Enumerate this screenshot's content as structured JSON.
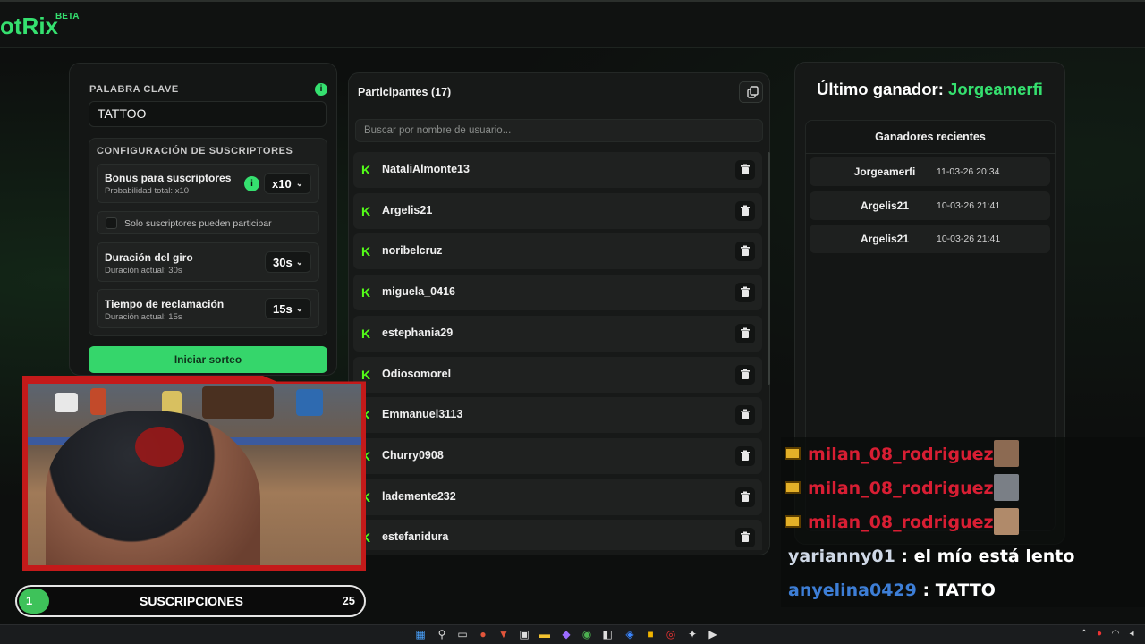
{
  "app": {
    "logo": "otRix",
    "beta": "BETA"
  },
  "settings": {
    "keyword_label": "PALABRA CLAVE",
    "keyword_value": "TATTOO",
    "subs_config_label": "CONFIGURACIÓN DE SUSCRIPTORES",
    "bonus_title": "Bonus para suscriptores",
    "bonus_sub": "Probabilidad total: x10",
    "bonus_value": "x10",
    "subs_only_label": "Solo suscriptores pueden participar",
    "spin_title": "Duración del giro",
    "spin_sub": "Duración actual: 30s",
    "spin_value": "30s",
    "claim_title": "Tiempo de reclamación",
    "claim_sub": "Duración actual: 15s",
    "claim_value": "15s",
    "start_label": "Iniciar sorteo",
    "info_glyph": "i"
  },
  "participants": {
    "title": "Participantes (17)",
    "search_placeholder": "Buscar por nombre de usuario...",
    "items": [
      "NataliAlmonte13",
      "Argelis21",
      "noribelcruz",
      "miguela_0416",
      "estephania29",
      "Odiosomorel",
      "Emmanuel3113",
      "Churry0908",
      "lademente232",
      "estefanidura"
    ]
  },
  "winner": {
    "label": "Último ganador:",
    "name": "Jorgeamerfi",
    "recent_title": "Ganadores recientes",
    "recent": [
      {
        "name": "Jorgeamerfi",
        "date": "11-03-26 20:34"
      },
      {
        "name": "Argelis21",
        "date": "10-03-26 21:41"
      },
      {
        "name": "Argelis21",
        "date": "10-03-26 21:41"
      }
    ]
  },
  "subs_goal": {
    "current": "1",
    "label": "SUSCRIPCIONES",
    "goal": "25",
    "progress_fraction": 0.04
  },
  "chat": [
    {
      "user": "milan_08_rodriguez",
      "sep": " :",
      "msg": "",
      "color": "#d81e33",
      "crown": true
    },
    {
      "user": "milan_08_rodriguez",
      "sep": " :",
      "msg": "",
      "color": "#d81e33",
      "crown": true
    },
    {
      "user": "milan_08_rodriguez",
      "sep": " :",
      "msg": "",
      "color": "#d81e33",
      "crown": true
    },
    {
      "user": "yarianny01",
      "sep": " :",
      "msg": " el mío está lento",
      "color": "#cfd8e6",
      "crown": false
    },
    {
      "user": "anyelina0429",
      "sep": " :",
      "msg": " TATTO",
      "color": "#3d7ed6",
      "crown": false
    }
  ],
  "colors": {
    "accent": "#35e06f",
    "kick": "#53fc18",
    "cam_border": "#c41a1a"
  },
  "icons": {
    "kick": "K",
    "trash": "trash-icon",
    "copy": "copy-icon",
    "chevron": "⌄"
  }
}
